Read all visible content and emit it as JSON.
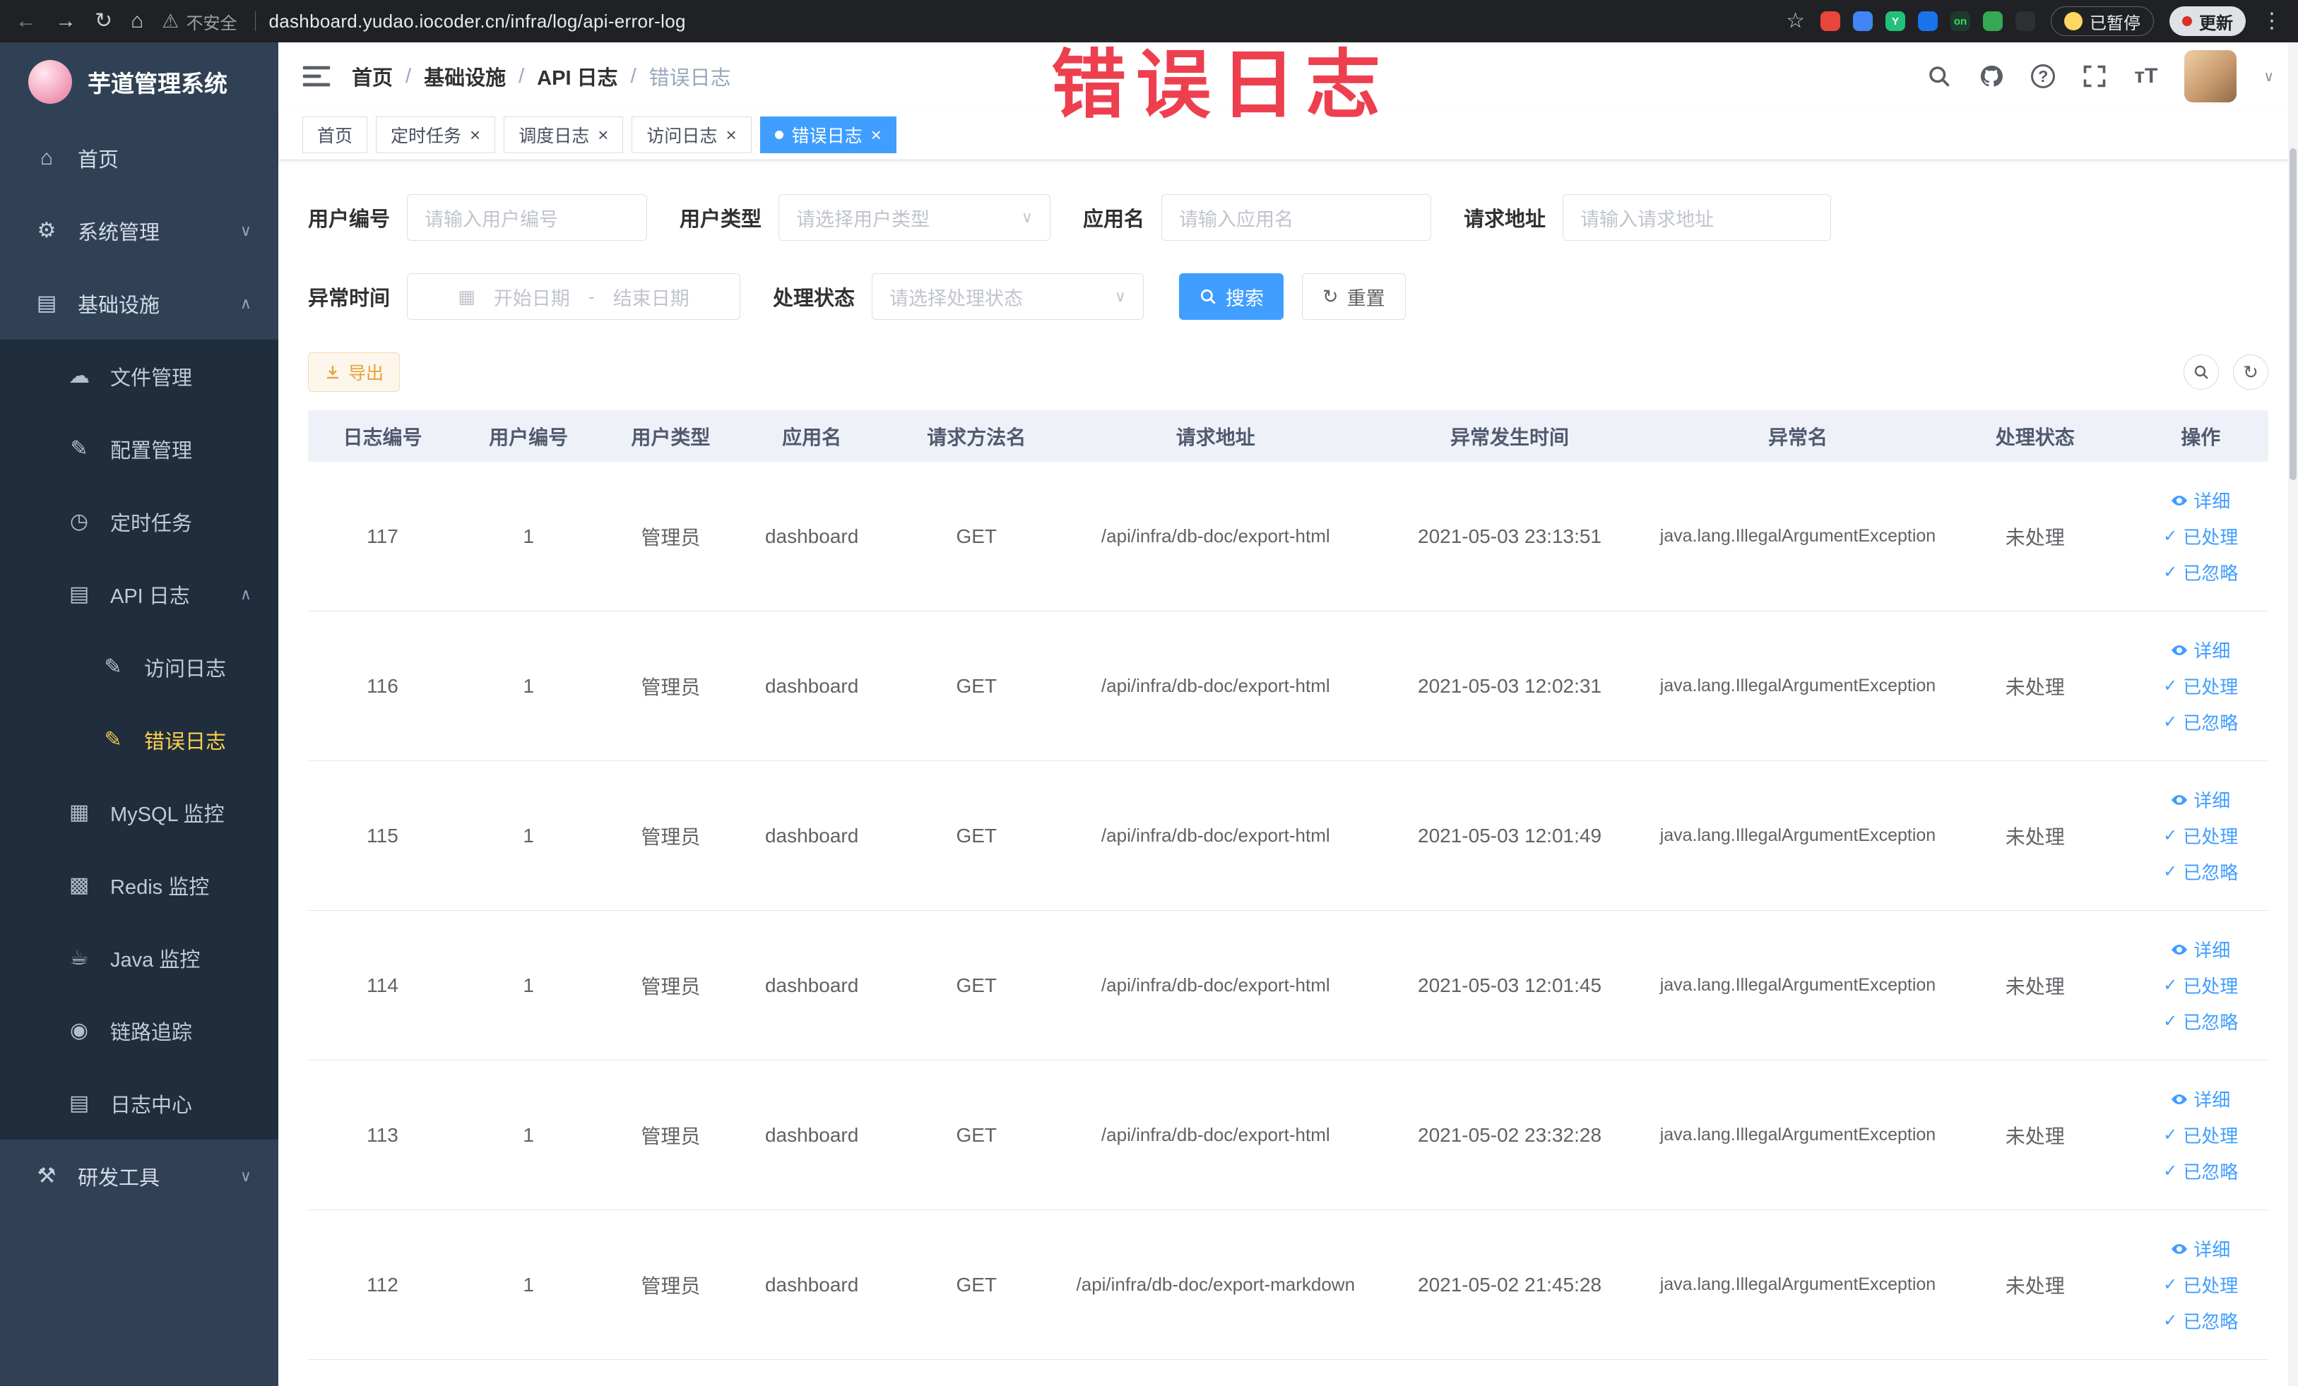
{
  "colors": {
    "accent": "#409eff",
    "warning": "#e6a23c",
    "sidebar_bg": "#304156",
    "sidebar_submenu_bg": "#1f2d3d",
    "sidebar_active_text": "#ffd04b",
    "tab_active_bg": "#409eff",
    "annotation_red": "#ee3f4f",
    "browser_bar_bg": "#202124",
    "table_header_bg": "#eef2f8"
  },
  "annotation": {
    "text": "错误日志"
  },
  "browser": {
    "security_label": "不安全",
    "url": "dashboard.yudao.iocoder.cn/infra/log/api-error-log",
    "paused_badge": "已暂停",
    "update_label": "更新",
    "extensions": [
      {
        "name": "extension-red-circle",
        "color": "#e8453c"
      },
      {
        "name": "extension-blue-drop",
        "color": "#4285f4"
      },
      {
        "name": "extension-green-y",
        "color": "#21c17a",
        "text": "Y"
      },
      {
        "name": "extension-blue-grid",
        "color": "#1a73e8"
      },
      {
        "name": "extension-on-switch",
        "color": "#1e3a2f",
        "text": "on",
        "text_color": "#35e05f"
      },
      {
        "name": "extension-green-leaf",
        "color": "#34a853"
      },
      {
        "name": "extension-dark-paw",
        "color": "#2d2f33"
      }
    ]
  },
  "sidebar": {
    "app_title": "芋道管理系统",
    "menu": [
      {
        "label": "首页",
        "icon": "home-icon",
        "level": 0
      },
      {
        "label": "系统管理",
        "icon": "gear-icon",
        "level": 0,
        "chevron": "down"
      },
      {
        "label": "基础设施",
        "icon": "infrastructure-icon",
        "level": 0,
        "chevron": "up"
      },
      {
        "label": "文件管理",
        "icon": "file-icon",
        "level": 1,
        "sub": true
      },
      {
        "label": "配置管理",
        "icon": "config-icon",
        "level": 1,
        "sub": true
      },
      {
        "label": "定时任务",
        "icon": "timer-icon",
        "level": 1,
        "sub": true
      },
      {
        "label": "API 日志",
        "icon": "api-log-icon",
        "level": 1,
        "sub": true,
        "chevron": "up"
      },
      {
        "label": "访问日志",
        "icon": "log-doc-icon",
        "level": 2,
        "sub": true
      },
      {
        "label": "错误日志",
        "icon": "log-doc-icon",
        "level": 2,
        "sub": true,
        "active": true
      },
      {
        "label": "MySQL 监控",
        "icon": "mysql-icon",
        "level": 1,
        "sub": true
      },
      {
        "label": "Redis 监控",
        "icon": "redis-icon",
        "level": 1,
        "sub": true
      },
      {
        "label": "Java 监控",
        "icon": "java-icon",
        "level": 1,
        "sub": true
      },
      {
        "label": "链路追踪",
        "icon": "trace-icon",
        "level": 1,
        "sub": true
      },
      {
        "label": "日志中心",
        "icon": "log-center-icon",
        "level": 1,
        "sub": true
      },
      {
        "label": "研发工具",
        "icon": "devtools-icon",
        "level": 0,
        "chevron": "down"
      }
    ]
  },
  "icon_glyphs": {
    "home-icon": "⌂",
    "gear-icon": "⚙",
    "infrastructure-icon": "▤",
    "file-icon": "☁",
    "config-icon": "✎",
    "timer-icon": "◷",
    "api-log-icon": "▤",
    "log-doc-icon": "✎",
    "mysql-icon": "▦",
    "redis-icon": "▩",
    "java-icon": "☕",
    "trace-icon": "◉",
    "log-center-icon": "▤",
    "devtools-icon": "⚒"
  },
  "header": {
    "breadcrumb": [
      "首页",
      "基础设施",
      "API 日志",
      "错误日志"
    ],
    "font_size_icon_text": "тT"
  },
  "tabs": [
    {
      "label": "首页",
      "closable": false,
      "active": false
    },
    {
      "label": "定时任务",
      "closable": true,
      "active": false
    },
    {
      "label": "调度日志",
      "closable": true,
      "active": false
    },
    {
      "label": "访问日志",
      "closable": true,
      "active": false
    },
    {
      "label": "错误日志",
      "closable": true,
      "active": true
    }
  ],
  "filters": {
    "user_id_label": "用户编号",
    "user_id_placeholder": "请输入用户编号",
    "user_type_label": "用户类型",
    "user_type_placeholder": "请选择用户类型",
    "app_name_label": "应用名",
    "app_name_placeholder": "请输入应用名",
    "request_url_label": "请求地址",
    "request_url_placeholder": "请输入请求地址",
    "exception_time_label": "异常时间",
    "start_date_placeholder": "开始日期",
    "range_separator": "-",
    "end_date_placeholder": "结束日期",
    "process_status_label": "处理状态",
    "process_status_placeholder": "请选择处理状态",
    "search_button": "搜索",
    "reset_button": "重置"
  },
  "toolbar": {
    "export_label": "导出"
  },
  "table": {
    "columns": [
      "日志编号",
      "用户编号",
      "用户类型",
      "应用名",
      "请求方法名",
      "请求地址",
      "异常发生时间",
      "异常名",
      "处理状态",
      "操作"
    ],
    "actions": [
      "详细",
      "已处理",
      "已忽略"
    ],
    "rows": [
      {
        "id": "117",
        "user_id": "1",
        "user_type": "管理员",
        "app": "dashboard",
        "method": "GET",
        "url": "/api/infra/db-doc/export-html",
        "time": "2021-05-03 23:13:51",
        "exception": "java.lang.IllegalArgumentException",
        "status": "未处理"
      },
      {
        "id": "116",
        "user_id": "1",
        "user_type": "管理员",
        "app": "dashboard",
        "method": "GET",
        "url": "/api/infra/db-doc/export-html",
        "time": "2021-05-03 12:02:31",
        "exception": "java.lang.IllegalArgumentException",
        "status": "未处理"
      },
      {
        "id": "115",
        "user_id": "1",
        "user_type": "管理员",
        "app": "dashboard",
        "method": "GET",
        "url": "/api/infra/db-doc/export-html",
        "time": "2021-05-03 12:01:49",
        "exception": "java.lang.IllegalArgumentException",
        "status": "未处理"
      },
      {
        "id": "114",
        "user_id": "1",
        "user_type": "管理员",
        "app": "dashboard",
        "method": "GET",
        "url": "/api/infra/db-doc/export-html",
        "time": "2021-05-03 12:01:45",
        "exception": "java.lang.IllegalArgumentException",
        "status": "未处理"
      },
      {
        "id": "113",
        "user_id": "1",
        "user_type": "管理员",
        "app": "dashboard",
        "method": "GET",
        "url": "/api/infra/db-doc/export-html",
        "time": "2021-05-02 23:32:28",
        "exception": "java.lang.IllegalArgumentException",
        "status": "未处理"
      },
      {
        "id": "112",
        "user_id": "1",
        "user_type": "管理员",
        "app": "dashboard",
        "method": "GET",
        "url": "/api/infra/db-doc/export-markdown",
        "time": "2021-05-02 21:45:28",
        "exception": "java.lang.IllegalArgumentException",
        "status": "未处理"
      }
    ]
  }
}
